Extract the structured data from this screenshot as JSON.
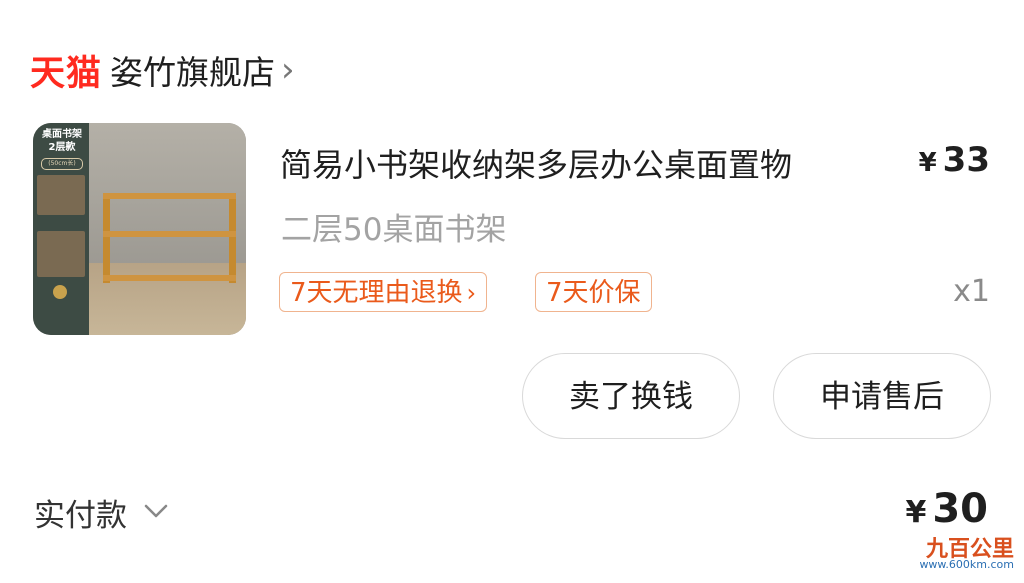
{
  "store": {
    "brand_badge": "天猫",
    "name": "姿竹旗舰店",
    "chevron": "›",
    "brand_color": "#ff2a1f"
  },
  "product": {
    "thumb": {
      "title": "桌面书架",
      "subtitle": "2层款",
      "size_note": "(50cm长)"
    },
    "title": "简易小书架收纳架多层办公桌面置物",
    "price_symbol": "¥",
    "price": "33",
    "sku": "二层50桌面书架",
    "tags": [
      {
        "label": "7天无理由退换",
        "arrow": "›"
      },
      {
        "label": "7天价保"
      }
    ],
    "quantity": "x1",
    "tag_color": "#ea5a1b"
  },
  "actions": {
    "sell_label": "卖了换钱",
    "aftersale_label": "申请售后"
  },
  "payment": {
    "label": "实付款",
    "symbol": "¥",
    "amount": "30"
  },
  "watermark": {
    "logo_text": "九百公里",
    "url": "www.600km.com"
  },
  "icons": {
    "store_chevron": "chevron-right-icon",
    "payment_chevron": "chevron-down-icon"
  }
}
